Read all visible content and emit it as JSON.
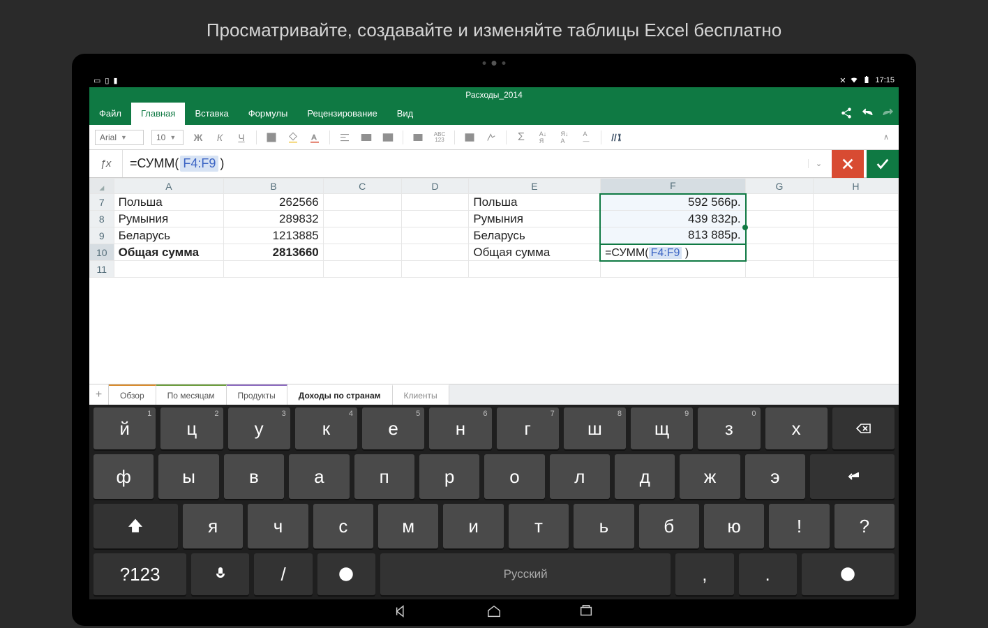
{
  "promo": "Просматривайте, создавайте и изменяйте таблицы Excel бесплатно",
  "status": {
    "time": "17:15"
  },
  "doc_title": "Расходы_2014",
  "tabs": [
    "Файл",
    "Главная",
    "Вставка",
    "Формулы",
    "Рецензирование",
    "Вид"
  ],
  "active_tab": 1,
  "font": {
    "name": "Arial",
    "size": "10",
    "bold": "Ж",
    "italic": "К",
    "underline": "Ч"
  },
  "formula": {
    "prefix": "=СУММ(",
    "ref": "F4:F9",
    "suffix": " )"
  },
  "columns": [
    "A",
    "B",
    "C",
    "D",
    "E",
    "F",
    "G",
    "H"
  ],
  "rows": [
    {
      "n": "7",
      "A": "Польша",
      "B": "262566",
      "E": "Польша",
      "F": "592 566р."
    },
    {
      "n": "8",
      "A": "Румыния",
      "B": "289832",
      "E": "Румыния",
      "F": "439 832р."
    },
    {
      "n": "9",
      "A": "Беларусь",
      "B": "1213885",
      "E": "Беларусь",
      "F": "813 885р."
    },
    {
      "n": "10",
      "A": "Общая сумма",
      "B": "2813660",
      "E": "Общая сумма",
      "F_formula_prefix": "=СУММ(",
      "F_formula_ref": "F4:F9",
      "F_formula_suffix": " )"
    },
    {
      "n": "11"
    }
  ],
  "sheets": [
    "Обзор",
    "По месяцам",
    "Продукты",
    "Доходы по странам",
    "Клиенты"
  ],
  "active_sheet": 3,
  "keyboard": {
    "row1": [
      {
        "k": "й",
        "h": "1"
      },
      {
        "k": "ц",
        "h": "2"
      },
      {
        "k": "у",
        "h": "3"
      },
      {
        "k": "к",
        "h": "4"
      },
      {
        "k": "е",
        "h": "5"
      },
      {
        "k": "н",
        "h": "6"
      },
      {
        "k": "г",
        "h": "7"
      },
      {
        "k": "ш",
        "h": "8"
      },
      {
        "k": "щ",
        "h": "9"
      },
      {
        "k": "з",
        "h": "0"
      },
      {
        "k": "х"
      }
    ],
    "row2": [
      {
        "k": "ф"
      },
      {
        "k": "ы"
      },
      {
        "k": "в"
      },
      {
        "k": "а"
      },
      {
        "k": "п"
      },
      {
        "k": "р"
      },
      {
        "k": "о"
      },
      {
        "k": "л"
      },
      {
        "k": "д"
      },
      {
        "k": "ж"
      },
      {
        "k": "э"
      }
    ],
    "row3": [
      {
        "k": "я"
      },
      {
        "k": "ч"
      },
      {
        "k": "с"
      },
      {
        "k": "м"
      },
      {
        "k": "и"
      },
      {
        "k": "т"
      },
      {
        "k": "ь"
      },
      {
        "k": "б"
      },
      {
        "k": "ю"
      },
      {
        "k": "!"
      },
      {
        "k": "?"
      }
    ],
    "row5": {
      "sym": "?123",
      "slash": "/",
      "space": "Русский",
      "comma": ",",
      "period": "."
    }
  }
}
